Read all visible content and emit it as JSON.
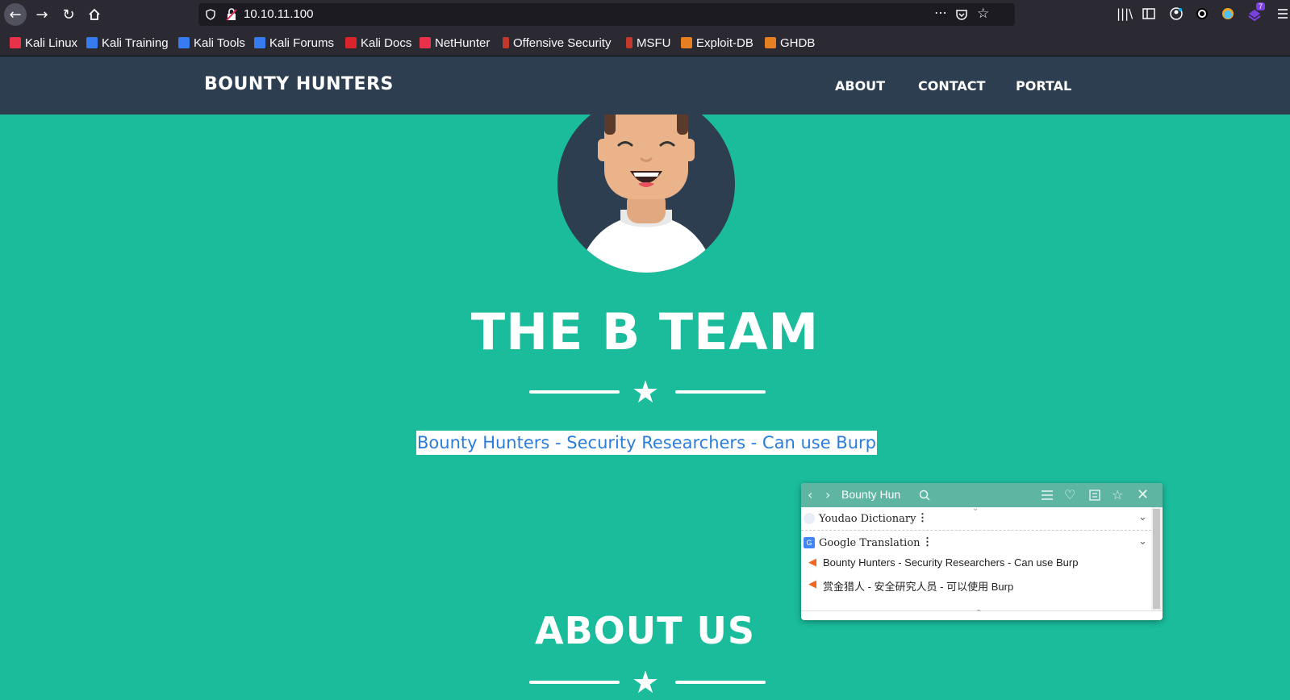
{
  "browser": {
    "url": "10.10.11.100",
    "bookmarks": [
      "Kali Linux",
      "Kali Training",
      "Kali Tools",
      "Kali Forums",
      "Kali Docs",
      "NetHunter",
      "Offensive Security",
      "MSFU",
      "Exploit-DB",
      "GHDB"
    ],
    "badge_count": "7",
    "icons": [
      "back-icon",
      "forward-icon",
      "reload-icon",
      "home-icon",
      "shield-icon",
      "insecure-lock-icon",
      "more-icon",
      "pocket-icon",
      "star-icon",
      "library-icon",
      "sidebar-icon",
      "account-icon",
      "extension-icon",
      "menu-icon"
    ]
  },
  "site": {
    "brand": "BOUNTY HUNTERS",
    "nav": [
      "ABOUT",
      "CONTACT",
      "PORTAL"
    ],
    "hero_title": "THE B TEAM",
    "subtitle": "Bounty Hunters - Security Researchers - Can use Burp",
    "about_title": "ABOUT US"
  },
  "popup": {
    "query": "Bounty Hun",
    "dictionaries": [
      "Youdao Dictionary",
      "Google Translation"
    ],
    "translations": [
      "Bounty Hunters - Security Researchers - Can use Burp",
      "赏金猎人 - 安全研究人员 - 可以使用 Burp"
    ]
  },
  "colors": {
    "page_bg": "#1abc9c",
    "navbar_bg": "#2c3e50",
    "chrome_bg": "#2b2a33",
    "popup_head": "#5eb5a2",
    "highlight_text": "#2b7ddb"
  }
}
